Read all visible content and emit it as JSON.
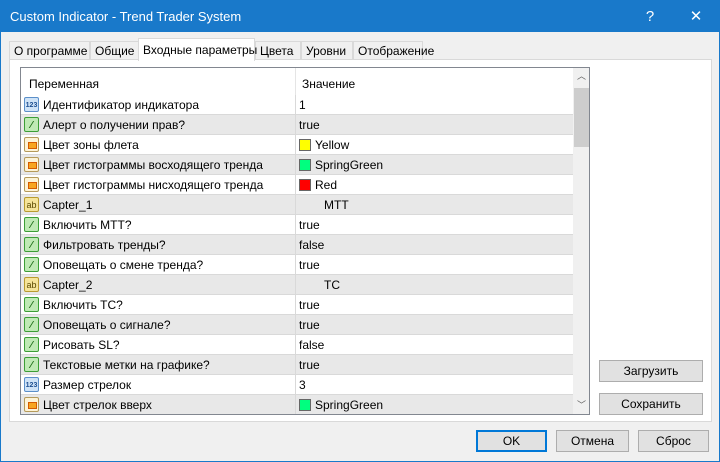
{
  "window": {
    "title": "Custom Indicator - Trend Trader System",
    "help": "?",
    "close": "✕"
  },
  "tabs": [
    {
      "label": "О программе"
    },
    {
      "label": "Общие"
    },
    {
      "label": "Входные параметры"
    },
    {
      "label": "Цвета"
    },
    {
      "label": "Уровни"
    },
    {
      "label": "Отображение"
    }
  ],
  "table": {
    "col_variable": "Переменная",
    "col_value": "Значение",
    "rows": [
      {
        "icon": "number-icon",
        "name": "Идентификатор индикатора",
        "value": "1"
      },
      {
        "icon": "bool-icon",
        "name": "Алерт о получении прав?",
        "value": "true"
      },
      {
        "icon": "color-icon",
        "name": "Цвет зоны флета",
        "value": "Yellow",
        "swatch": "#ffff00"
      },
      {
        "icon": "color-icon",
        "name": "Цвет гистограммы восходящего тренда",
        "value": "SpringGreen",
        "swatch": "#00ff7f"
      },
      {
        "icon": "color-icon",
        "name": "Цвет гистограммы нисходящего тренда",
        "value": "Red",
        "swatch": "#ff0000"
      },
      {
        "icon": "string-icon",
        "name": "Capter_1",
        "value": "MTT"
      },
      {
        "icon": "bool-icon",
        "name": "Включить MTT?",
        "value": "true"
      },
      {
        "icon": "bool-icon",
        "name": "Фильтровать тренды?",
        "value": "false"
      },
      {
        "icon": "bool-icon",
        "name": "Оповещать о смене тренда?",
        "value": "true"
      },
      {
        "icon": "string-icon",
        "name": "Capter_2",
        "value": "TC"
      },
      {
        "icon": "bool-icon",
        "name": "Включить TC?",
        "value": "true"
      },
      {
        "icon": "bool-icon",
        "name": "Оповещать о сигнале?",
        "value": "true"
      },
      {
        "icon": "bool-icon",
        "name": "Рисовать SL?",
        "value": "false"
      },
      {
        "icon": "bool-icon",
        "name": "Текстовые метки на графике?",
        "value": "true"
      },
      {
        "icon": "number-icon",
        "name": "Размер стрелок",
        "value": "3"
      },
      {
        "icon": "color-icon",
        "name": "Цвет стрелок вверх",
        "value": "SpringGreen",
        "swatch": "#00ff7f"
      }
    ]
  },
  "icon_labels": {
    "number": "123",
    "string": "ab",
    "bool": "⁄"
  },
  "buttons": {
    "load": "Загрузить",
    "save": "Сохранить",
    "ok": "OK",
    "cancel": "Отмена",
    "reset": "Сброс"
  },
  "colors": {
    "titlebar": "#1979ca",
    "default_button_border": "#0078d7"
  }
}
